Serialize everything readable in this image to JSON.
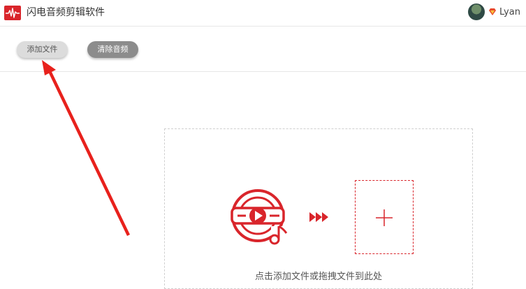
{
  "app": {
    "title": "闪电音频剪辑软件",
    "logo_icon": "waveform-logo-icon"
  },
  "user": {
    "name": "Lyan",
    "vip_icon": "vip-diamond-icon"
  },
  "toolbar": {
    "add_file_label": "添加文件",
    "clear_audio_label": "清除音频"
  },
  "dropzone": {
    "hint": "点击添加文件或拖拽文件到此处"
  },
  "colors": {
    "accent": "#d9252b",
    "clear_button_bg": "#8c8c8c",
    "add_button_bg": "#dcdcdc"
  }
}
